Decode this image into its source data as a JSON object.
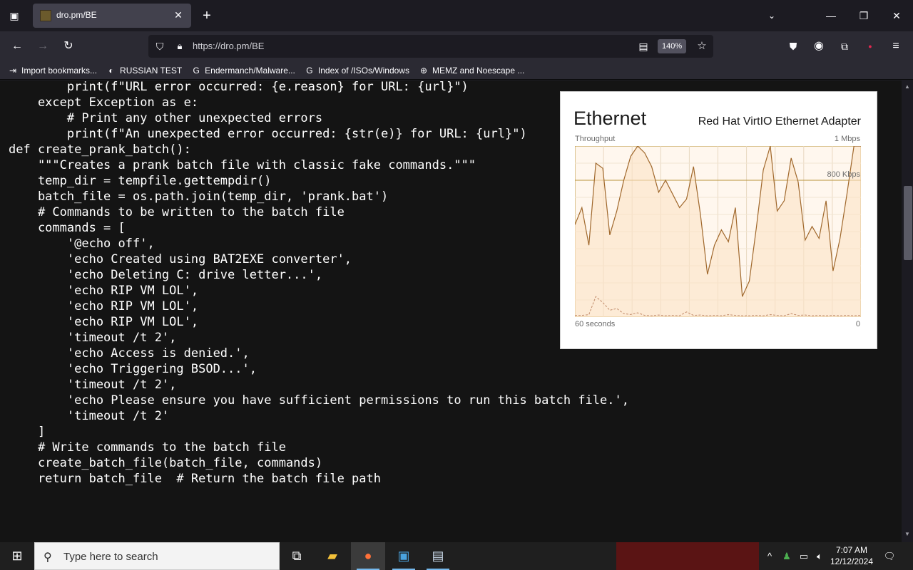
{
  "browser": {
    "tab_title": "dro.pm/BE",
    "url": "https://dro.pm/BE",
    "zoom": "140%"
  },
  "bookmarks": [
    {
      "label": "Import bookmarks...",
      "icon": "import-icon"
    },
    {
      "label": "RUSSIAN TEST",
      "icon": "github-icon"
    },
    {
      "label": "Endermanch/Malware...",
      "icon": "google-icon"
    },
    {
      "label": "Index of /ISOs/Windows",
      "icon": "google-icon"
    },
    {
      "label": "MEMZ and Noescape ...",
      "icon": "globe-icon"
    }
  ],
  "code": {
    "lines": [
      "        print(f\"URL error occurred: {e.reason} for URL: {url}\")",
      "    except Exception as e:",
      "        # Print any other unexpected errors",
      "        print(f\"An unexpected error occurred: {str(e)} for URL: {url}\")",
      "",
      "def create_prank_batch():",
      "    \"\"\"Creates a prank batch file with classic fake commands.\"\"\"",
      "    temp_dir = tempfile.gettempdir()",
      "    batch_file = os.path.join(temp_dir, 'prank.bat')",
      "",
      "    # Commands to be written to the batch file",
      "    commands = [",
      "        '@echo off',",
      "        'echo Created using BAT2EXE converter',",
      "        'echo Deleting C: drive letter...',",
      "        'echo RIP VM LOL',",
      "        'echo RIP VM LOL',",
      "        'echo RIP VM LOL',",
      "        'timeout /t 2',",
      "        'echo Access is denied.',",
      "        'echo Triggering BSOD...',",
      "        'timeout /t 2',",
      "        'echo Please ensure you have sufficient permissions to run this batch file.',",
      "        'timeout /t 2'",
      "    ]",
      "",
      "    # Write commands to the batch file",
      "    create_batch_file(batch_file, commands)",
      "",
      "    return batch_file  # Return the batch file path"
    ]
  },
  "ethernet": {
    "title": "Ethernet",
    "adapter": "Red Hat VirtIO Ethernet Adapter",
    "throughput_label": "Throughput",
    "max_label": "1 Mbps",
    "mid_label": "800 Kbps",
    "time_label": "60 seconds",
    "zero_label": "0",
    "send_series_kbps": [
      540,
      640,
      420,
      900,
      870,
      480,
      620,
      800,
      940,
      1000,
      960,
      880,
      730,
      800,
      720,
      640,
      690,
      880,
      600,
      250,
      420,
      510,
      440,
      640,
      120,
      210,
      520,
      860,
      1000,
      620,
      680,
      930,
      790,
      450,
      530,
      460,
      680,
      270,
      460,
      720,
      1000,
      1000
    ],
    "receive_series_kbps": [
      10,
      10,
      14,
      120,
      85,
      40,
      50,
      20,
      15,
      25,
      10,
      8,
      12,
      8,
      10,
      8,
      30,
      10,
      12,
      8,
      10,
      8,
      14,
      10,
      8,
      8,
      10,
      8,
      14,
      10,
      8,
      20,
      10,
      12,
      8,
      10,
      8,
      10,
      8,
      10,
      8,
      10
    ]
  },
  "taskbar": {
    "search_placeholder": "Type here to search",
    "time": "7:07 AM",
    "date": "12/12/2024"
  }
}
